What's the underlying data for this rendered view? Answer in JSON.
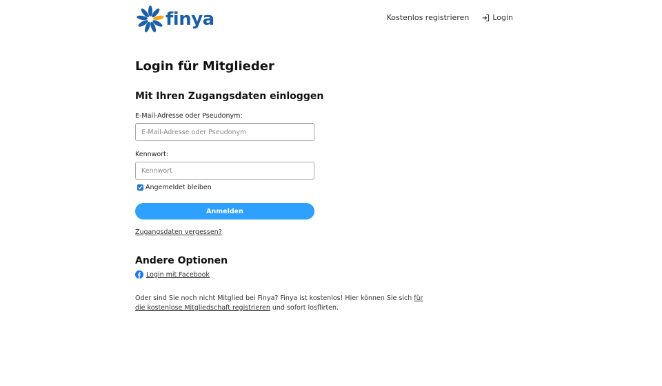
{
  "header": {
    "logo_text": "finya",
    "nav_register": "Kostenlos registrieren",
    "nav_login": "Login"
  },
  "main": {
    "title": "Login für Mitglieder",
    "subtitle": "Mit Ihren Zugangsdaten einloggen",
    "email_label": "E-Mail-Adresse oder Pseudonym:",
    "email_placeholder": "E-Mail-Adresse oder Pseudonym",
    "password_label": "Kennwort:",
    "password_placeholder": "Kennwort",
    "remember_label": "Angemeldet bleiben",
    "remember_checked": true,
    "submit_label": "Anmelden",
    "forgot_link": "Zugangsdaten vergessen?",
    "other_title": "Andere Optionen",
    "facebook_link": "Login mit Facebook",
    "footer_text_1": "Oder sind Sie noch nicht Mitglied bei Finya? Finya ist kostenlos! Hier können Sie sich ",
    "footer_link": "für die kostenlose Mitgliedschaft registrieren",
    "footer_text_2": " und sofort losflirten."
  },
  "colors": {
    "brand_blue": "#1b5fa8",
    "logo_orange": "#f2a81d",
    "button_blue": "#2ea0ff",
    "facebook_blue": "#1877f2"
  },
  "icons": {
    "logo": "finya-flower-icon",
    "login": "login-arrow-icon",
    "facebook": "facebook-icon"
  }
}
